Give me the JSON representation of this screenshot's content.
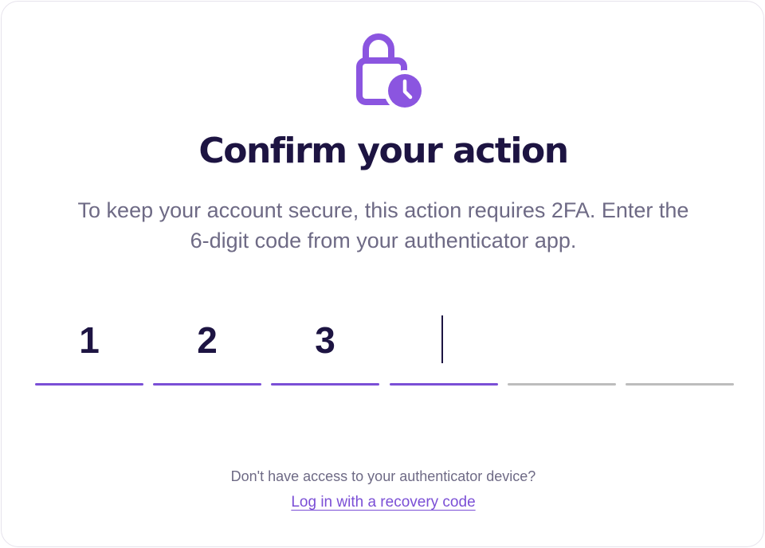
{
  "colors": {
    "accent": "#7b4fd6",
    "title": "#1d1442",
    "muted": "#6e6a85",
    "empty_line": "#bdbdbd"
  },
  "icon": "lock-clock-icon",
  "title": "Confirm your action",
  "subtitle_line1": "To keep your account secure, this action requires 2FA. Enter the",
  "subtitle_line2": "6-digit code from your authenticator app.",
  "otp": {
    "digits": [
      "1",
      "2",
      "3",
      "",
      "",
      ""
    ],
    "active_index": 3
  },
  "help_text": "Don't have access to your authenticator device?",
  "recovery_link": "Log in with a recovery code"
}
